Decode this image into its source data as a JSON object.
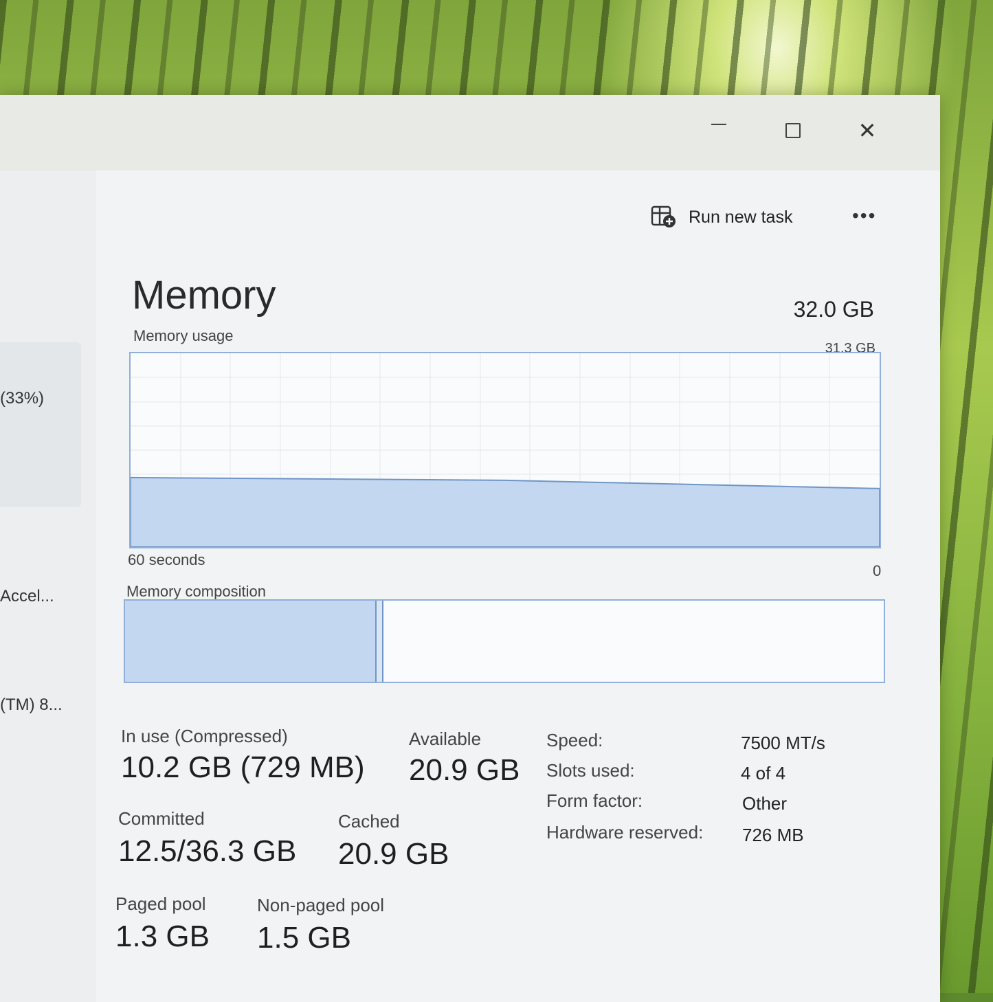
{
  "sidebar": {
    "items": [
      {
        "label": "(33%)"
      },
      {
        "label": "Accel..."
      },
      {
        "label": "(TM) 8..."
      }
    ]
  },
  "toolbar": {
    "run_new_task_label": "Run new task",
    "more_label": "•••"
  },
  "window_controls": {
    "close_glyph": "✕"
  },
  "memory": {
    "title": "Memory",
    "total": "32.0 GB",
    "usage_graph": {
      "label": "Memory usage",
      "max_label": "31.3 GB",
      "time_label": "60 seconds",
      "zero_label": "0",
      "usage_fraction": 0.33
    },
    "composition": {
      "label": "Memory composition",
      "in_use_fraction": 0.33
    },
    "stats": {
      "in_use": {
        "label": "In use (Compressed)",
        "value": "10.2 GB (729 MB)"
      },
      "available": {
        "label": "Available",
        "value": "20.9 GB"
      },
      "committed": {
        "label": "Committed",
        "value": "12.5/36.3 GB"
      },
      "cached": {
        "label": "Cached",
        "value": "20.9 GB"
      },
      "paged_pool": {
        "label": "Paged pool",
        "value": "1.3 GB"
      },
      "non_paged_pool": {
        "label": "Non-paged pool",
        "value": "1.5 GB"
      }
    },
    "specs": {
      "speed": {
        "label": "Speed:",
        "value": "7500 MT/s"
      },
      "slots": {
        "label": "Slots used:",
        "value": "4 of 4"
      },
      "form_factor": {
        "label": "Form factor:",
        "value": "Other"
      },
      "hw_reserved": {
        "label": "Hardware reserved:",
        "value": "726 MB"
      }
    }
  },
  "colors": {
    "accent_fill": "#c3d7f0",
    "accent_border": "#8fb0d8"
  }
}
